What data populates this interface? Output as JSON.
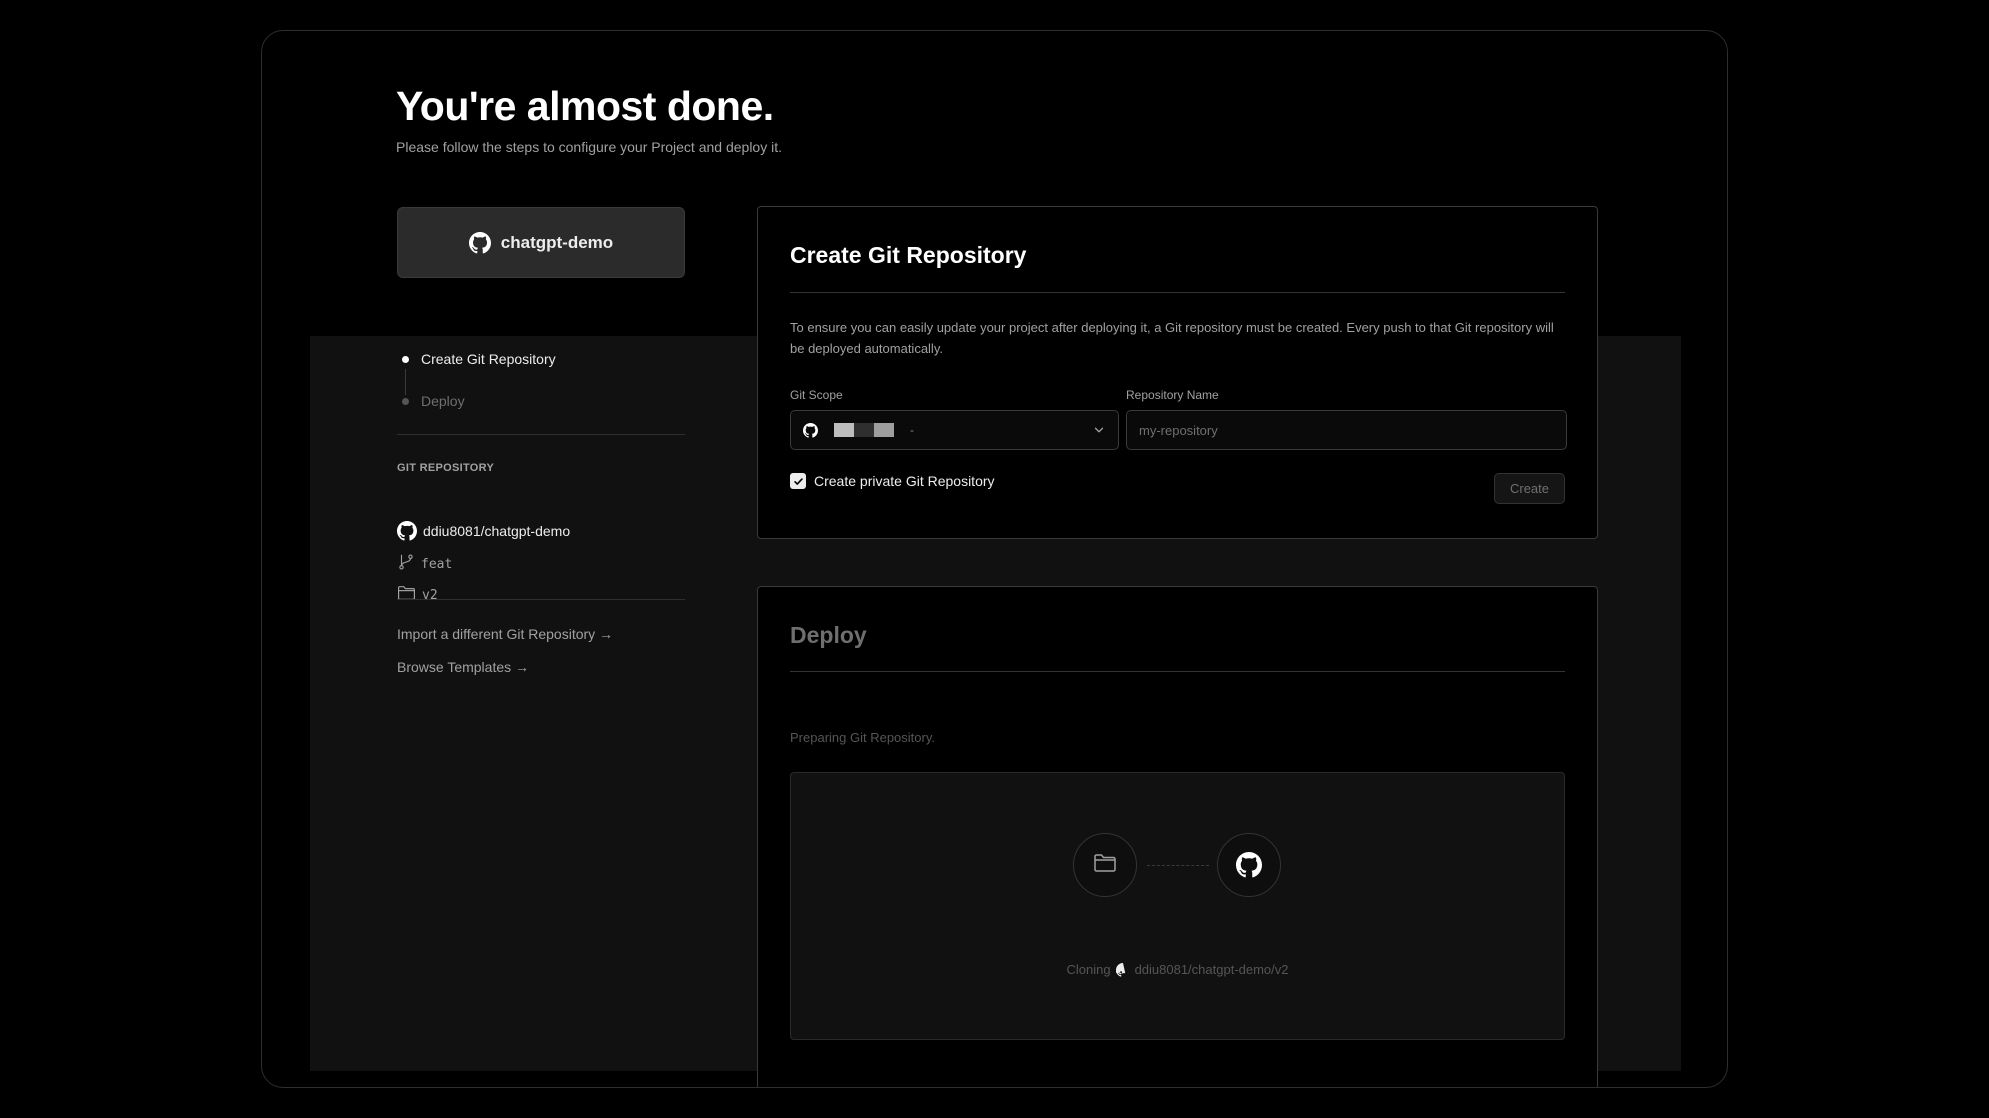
{
  "header": {
    "title": "You're almost done.",
    "subtitle": "Please follow the steps to configure your Project and deploy it."
  },
  "repo_card": {
    "name": "chatgpt-demo",
    "icon": "github-icon"
  },
  "steps": [
    {
      "label": "Create Git Repository",
      "state": "active"
    },
    {
      "label": "Deploy",
      "state": "pending"
    }
  ],
  "git_repository": {
    "section_label": "GIT REPOSITORY",
    "repo": "ddiu8081/chatgpt-demo",
    "branch": "feat",
    "directory": "v2"
  },
  "links": {
    "import": "Import a different Git Repository →",
    "templates": "Browse Templates →"
  },
  "create_panel": {
    "title": "Create Git Repository",
    "description": "To ensure you can easily update your project after deploying it, a Git repository must be created. Every push to that Git repository will be deployed automatically.",
    "scope_label": "Git Scope",
    "scope_value": "-",
    "repo_name_label": "Repository Name",
    "repo_name_placeholder": "my-repository",
    "private_label": "Create private Git Repository",
    "private_checked": true,
    "create_button": "Create"
  },
  "deploy_panel": {
    "title": "Deploy",
    "status": "Preparing Git Repository.",
    "cloning_prefix": "Cloning",
    "cloning_target": "ddiu8081/chatgpt-demo/v2"
  },
  "colors": {
    "background": "#000000",
    "band": "#111111",
    "text": "#ededed",
    "muted": "#a1a1a1"
  }
}
